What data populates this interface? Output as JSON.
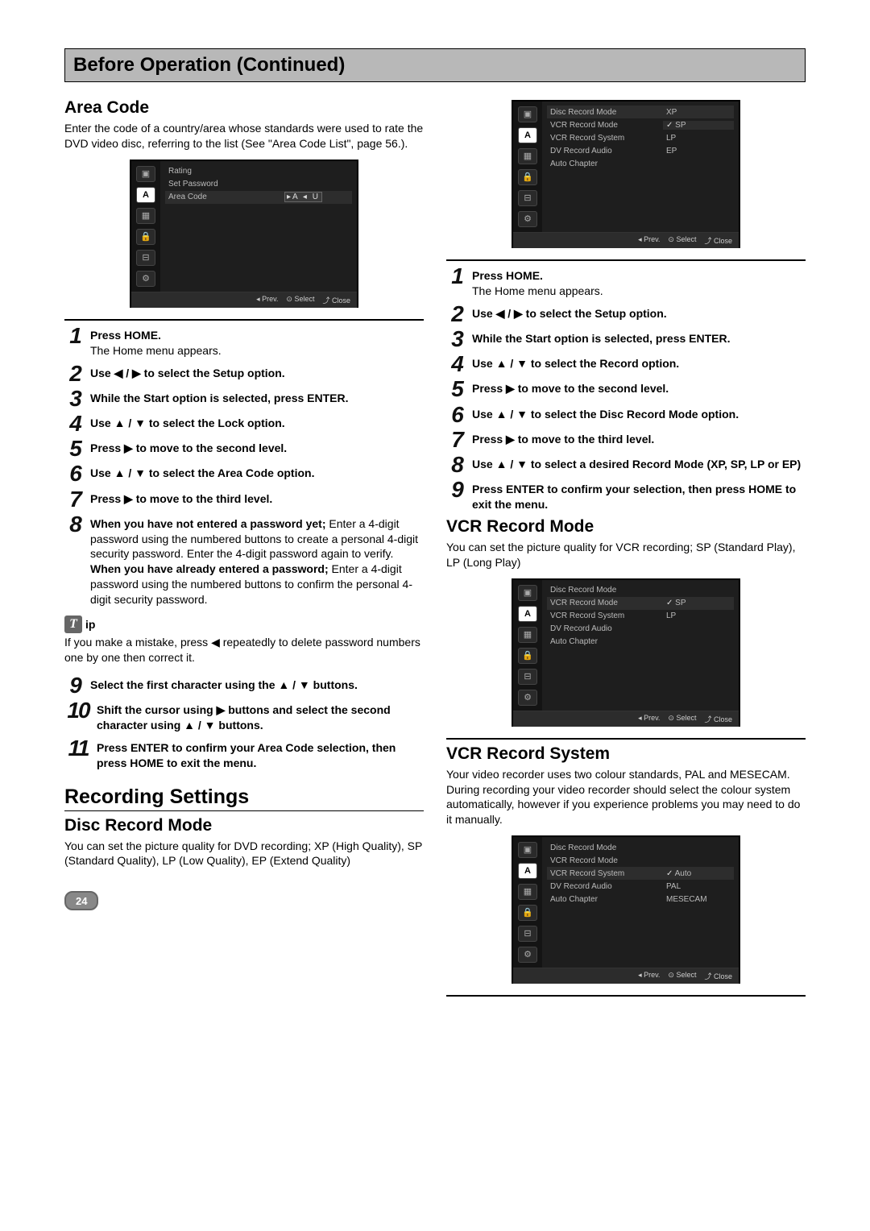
{
  "title": "Before Operation (Continued)",
  "page_number": "24",
  "left": {
    "area_code": {
      "heading": "Area Code",
      "intro": "Enter the code of a country/area whose standards were used to rate the DVD video disc, referring to the list (See \"Area Code List\", page 56.).",
      "ui": {
        "items": [
          "Rating",
          "Set Password",
          "Area Code"
        ],
        "selected": "Area Code",
        "value_box": "▸A ◂ U",
        "footer_prev": "◂ Prev.",
        "footer_select": "⊙ Select",
        "footer_close": "⤴ Close"
      },
      "steps": [
        {
          "n": "1",
          "bold": "Press HOME.",
          "rest": "The Home menu appears."
        },
        {
          "n": "2",
          "bold": "Use ◀ / ▶ to select the Setup option."
        },
        {
          "n": "3",
          "bold": "While the Start option is selected, press ENTER."
        },
        {
          "n": "4",
          "bold": "Use ▲ / ▼ to select the Lock option."
        },
        {
          "n": "5",
          "bold": "Press ▶ to move to the second level."
        },
        {
          "n": "6",
          "bold": "Use ▲ / ▼ to select the Area Code option."
        },
        {
          "n": "7",
          "bold": "Press ▶ to move to the third level."
        },
        {
          "n": "8",
          "bold": "When you have not entered a password yet;",
          "rest": "Enter a 4-digit password using the numbered buttons to create a personal 4-digit security password. Enter the 4-digit password again to verify.",
          "bold2": "When you have already entered a password;",
          "rest2": "Enter a 4-digit password using the numbered buttons to confirm the personal 4-digit security password."
        }
      ],
      "tip_icon": "T",
      "tip_label": "ip",
      "tip_body": "If you make a mistake, press ◀ repeatedly to delete password numbers one by one then correct it.",
      "steps_after_tip": [
        {
          "n": "9",
          "bold": "Select the first character using the ▲ / ▼ buttons."
        },
        {
          "n": "10",
          "bold": "Shift the cursor using ▶ buttons and select the second character using ▲ / ▼ buttons."
        },
        {
          "n": "11",
          "bold": "Press ENTER to confirm your Area Code selection, then press HOME to exit the menu."
        }
      ]
    },
    "recording_settings": {
      "heading": "Recording Settings",
      "disc_heading": "Disc Record Mode",
      "disc_intro": "You can set the picture quality for DVD recording; XP (High Quality), SP (Standard Quality), LP (Low Quality), EP (Extend Quality)"
    }
  },
  "right": {
    "disc_ui": {
      "items": [
        "Disc Record Mode",
        "VCR Record Mode",
        "VCR Record System",
        "DV Record Audio",
        "Auto Chapter"
      ],
      "selected": "Disc Record Mode",
      "opts": [
        "XP",
        "SP",
        "LP",
        "EP"
      ],
      "checked": "SP",
      "footer_prev": "◂ Prev.",
      "footer_select": "⊙ Select",
      "footer_close": "⤴ Close"
    },
    "steps": [
      {
        "n": "1",
        "bold": "Press HOME.",
        "rest": "The Home menu appears."
      },
      {
        "n": "2",
        "bold": "Use ◀ / ▶ to select the Setup option."
      },
      {
        "n": "3",
        "bold": "While the Start option is selected, press ENTER."
      },
      {
        "n": "4",
        "bold": "Use ▲ / ▼ to select the Record option."
      },
      {
        "n": "5",
        "bold": "Press ▶ to move to the second level."
      },
      {
        "n": "6",
        "bold": "Use ▲ / ▼ to select the Disc Record Mode option."
      },
      {
        "n": "7",
        "bold": "Press ▶ to move to the third level."
      },
      {
        "n": "8",
        "bold": "Use ▲ / ▼ to select a desired Record Mode (XP, SP, LP or EP)"
      },
      {
        "n": "9",
        "bold": "Press ENTER to confirm your selection, then press HOME to exit the menu."
      }
    ],
    "vcr_mode": {
      "heading": "VCR Record Mode",
      "intro": "You can set the picture quality for VCR recording; SP (Standard Play), LP (Long Play)",
      "ui": {
        "items": [
          "Disc Record Mode",
          "VCR Record Mode",
          "VCR Record System",
          "DV Record Audio",
          "Auto Chapter"
        ],
        "selected": "VCR Record Mode",
        "opts": [
          "SP",
          "LP"
        ],
        "checked": "SP",
        "footer_prev": "◂ Prev.",
        "footer_select": "⊙ Select",
        "footer_close": "⤴ Close"
      }
    },
    "vcr_system": {
      "heading": "VCR Record System",
      "intro": "Your video recorder uses two colour standards, PAL and MESECAM. During recording your video recorder should select the colour system automatically, however if you experience problems you may need to do it manually.",
      "ui": {
        "items": [
          "Disc Record Mode",
          "VCR Record Mode",
          "VCR Record System",
          "DV Record Audio",
          "Auto Chapter"
        ],
        "selected": "VCR Record System",
        "opts": [
          "Auto",
          "PAL",
          "MESECAM"
        ],
        "checked": "Auto",
        "footer_prev": "◂ Prev.",
        "footer_select": "⊙ Select",
        "footer_close": "⤴ Close"
      }
    }
  },
  "side_icons": [
    "▣",
    "A",
    "▦",
    "🔒",
    "⊟",
    "⚙"
  ]
}
